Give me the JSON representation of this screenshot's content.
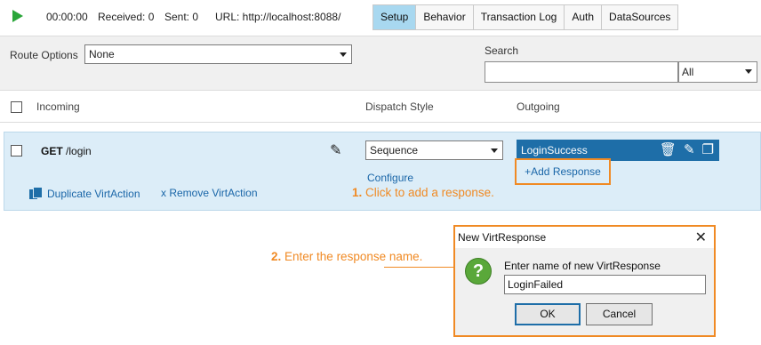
{
  "toolbar": {
    "timer": "00:00:00",
    "received": "Received: 0",
    "sent": "Sent: 0",
    "url": "URL: http://localhost:8088/",
    "tabs": [
      "Setup",
      "Behavior",
      "Transaction Log",
      "Auth",
      "DataSources"
    ],
    "active_tab": "Setup"
  },
  "options": {
    "route_label": "Route Options",
    "route_value": "None",
    "search_label": "Search",
    "search_value": "",
    "filter_value": "All"
  },
  "header": {
    "incoming": "Incoming",
    "dispatch_style": "Dispatch Style",
    "outgoing": "Outgoing"
  },
  "action": {
    "method": "GET",
    "path": "/login",
    "dispatch_value": "Sequence",
    "response_name": "LoginSuccess",
    "configure": "Configure",
    "add_response": "+Add Response",
    "duplicate": "Duplicate VirtAction",
    "remove": "x Remove VirtAction"
  },
  "callouts": {
    "step1_num": "1.",
    "step1_text": "Click to add a response.",
    "step2_num": "2.",
    "step2_text": "Enter the response name."
  },
  "dialog": {
    "title": "New VirtResponse",
    "prompt": "Enter name of new VirtResponse",
    "value": "LoginFailed",
    "ok": "OK",
    "cancel": "Cancel",
    "close_glyph": "✕",
    "question_glyph": "?"
  },
  "icons": {
    "pencil_glyph": "✎",
    "trash_glyph": "🗑",
    "copy_glyph": "❐"
  },
  "colors": {
    "accent_orange": "#f08a24",
    "link_blue": "#1a66a8",
    "response_bar": "#1e6ea8",
    "active_tab": "#a8d8f0",
    "row_bg": "#dcedf8"
  }
}
